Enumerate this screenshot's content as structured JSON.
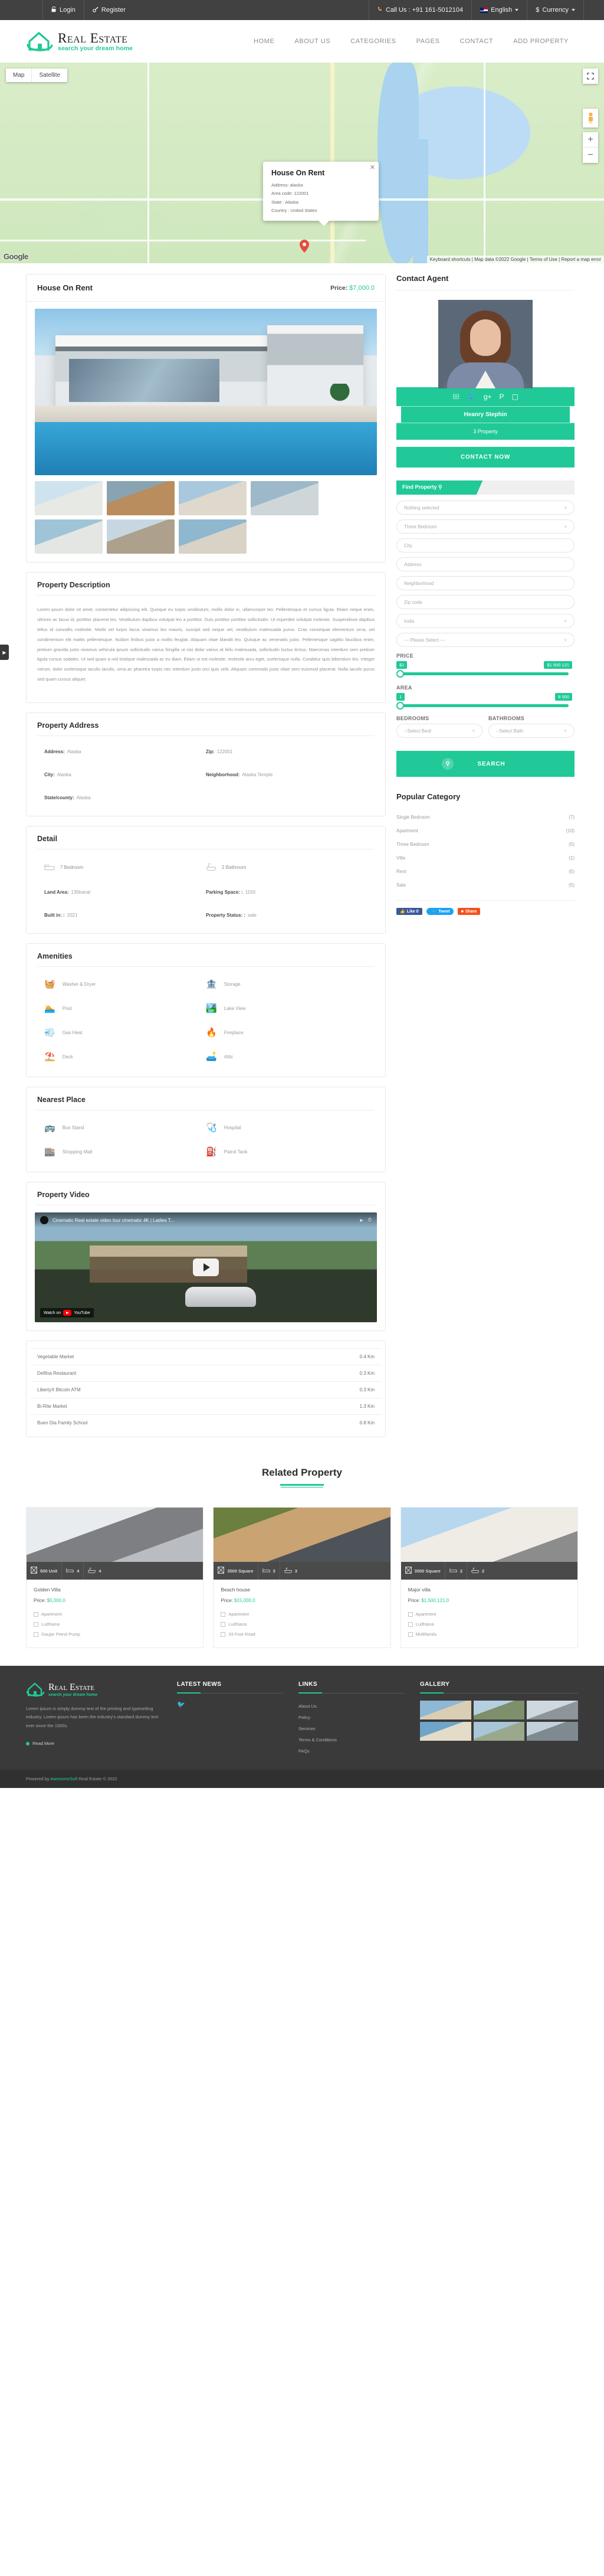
{
  "topbar": {
    "left": [
      {
        "icon": "lock-icon",
        "label": "Login"
      },
      {
        "icon": "key-icon",
        "label": "Register"
      }
    ],
    "call_us": "Call Us : +91 161-5012104",
    "language": "English",
    "currency": "Currency"
  },
  "header": {
    "logo_title": "Real Estate",
    "logo_sub": "search your dream home",
    "nav": [
      "HOME",
      "ABOUT US",
      "CATEGORIES",
      "PAGES",
      "CONTACT",
      "ADD PROPERTY"
    ]
  },
  "map": {
    "btn_map": "Map",
    "btn_satellite": "Satellite",
    "zoom_in": "+",
    "zoom_out": "−",
    "google_logo": "Google",
    "attribution": "Keyboard shortcuts | Map data ©2022 Google | Terms of Use | Report a map error",
    "info": {
      "title": "House On Rent",
      "address": "Address: alaska",
      "area_code": "Area code: 122001",
      "state": "State : Alaska",
      "country": "Country : United States"
    }
  },
  "property": {
    "title": "House On Rent",
    "price_label": "Price:",
    "price_value": "$7,000.0",
    "description_heading": "Property Description",
    "description_p1": "Lorem ipsum dolor sit amet, consectetur adipiscing elit. Quisque eu turpis vestibulum, mollis dolor in, ullamcorper leo. Pellentesque et cursus ligula. Etiam neque enim, ultrices ac lacus id, porttitor placerat leo. Vestibulum dapibus volutpat leo a porttitor. Duis porttitor porttitor sollicitudin. Ut imperdiet volutpat molestie. Suspendisse dapibus tellus id convallis molestie. Morbi vel turpis lacus vivamus leo mauris, suscipit sed neque vel, vestibulum malesuada purus. Cras consequat elementum urna, vel condimentum elit mattis pellentesque. Nullam finibus justo a mollis feugiat. Aliquam vitae blandit leo. Quisque ac venenatis justo. Pellentesque sagittis faucibus enim, pretium gravida justo vivamus vehicula ipsum sollicitudin varius fringilla ut nisi dolor varius at felis malesuada, sollicitudin luctus lectus. Maecenas interdum sem pretium ligula cursus sodales. Ut sed quam a nisl tristique malesuada ac eu diam. Etiam ut est molestie, molestie arcu eget, scelerisque nulla. Curabitur quis bibendum leo. Integer rutrum, dolor scelerisque iaculis iaculis, urna ac pharetra turpis nec interdum justo orci quis velit. Aliquam commodo justo vitae sem euismod placerat. Nulla iaculis purus sed quam cursus aliquet.",
    "address_heading": "Property Address",
    "address": [
      {
        "label": "Address:",
        "value": "Alaska"
      },
      {
        "label": "Zip:",
        "value": "122001"
      },
      {
        "label": "City:",
        "value": "Alaska"
      },
      {
        "label": "Neighborhood:",
        "value": "Alaska Temple"
      },
      {
        "label": "State/county:",
        "value": "Alaska"
      }
    ],
    "detail_heading": "Detail",
    "detail_icons": [
      {
        "icon": "bed-icon",
        "label": "7 Bedroom"
      },
      {
        "icon": "bath-icon",
        "label": "2 Bathroom"
      }
    ],
    "detail_fields": [
      {
        "label": "Land Area:",
        "value": "135kanal"
      },
      {
        "label": "Parking Space: :",
        "value": "1150"
      },
      {
        "label": "Built in: :",
        "value": "2021"
      },
      {
        "label": "Property Status: :",
        "value": "sale"
      }
    ],
    "amenities_heading": "Amenities",
    "amenities": [
      {
        "icon": "washer-icon",
        "emoji": "🧺",
        "label": "Washer & Dryer"
      },
      {
        "icon": "storage-icon",
        "emoji": "🏦",
        "label": "Storage"
      },
      {
        "icon": "pool-icon",
        "emoji": "🏊",
        "label": "Pool"
      },
      {
        "icon": "lake-view-icon",
        "emoji": "🏞️",
        "label": "Lake View"
      },
      {
        "icon": "gas-heat-icon",
        "emoji": "💨",
        "label": "Gas Heat"
      },
      {
        "icon": "fireplace-icon",
        "emoji": "🔥",
        "label": "Fireplace"
      },
      {
        "icon": "deck-icon",
        "emoji": "⛱️",
        "label": "Deck"
      },
      {
        "icon": "attic-icon",
        "emoji": "🛋️",
        "label": "Attic"
      }
    ],
    "nearest_heading": "Nearest Place",
    "nearest": [
      {
        "icon": "bus-stand-icon",
        "emoji": "🚌",
        "label": "Bus Stand"
      },
      {
        "icon": "hospital-icon",
        "emoji": "🩺",
        "label": "Hospital"
      },
      {
        "icon": "shopping-mall-icon",
        "emoji": "🏬",
        "label": "Shopping Mall"
      },
      {
        "icon": "petrol-tank-icon",
        "emoji": "⛽",
        "label": "Patrol Tank"
      }
    ],
    "video_heading": "Property Video",
    "video_title": "Cinematic Real estate video tour cinematic 4K | Ladies T...",
    "video_watch": "Watch on",
    "video_watch_brand": "YouTube",
    "distances": [
      {
        "name": "Vegetable Market",
        "distance": "0.4 Km"
      },
      {
        "name": "Delfina Restaurant",
        "distance": "0.3 Km"
      },
      {
        "name": "LibertyX Bitcoin ATM",
        "distance": "0.3 Km"
      },
      {
        "name": "Bi-Rite Market",
        "distance": "1.3 Km"
      },
      {
        "name": "Buen Dia Family School",
        "distance": "0.8 Km"
      }
    ]
  },
  "sidebar": {
    "contact_agent_title": "Contact Agent",
    "agent_name": "Heanry Stephin",
    "agent_properties": "3 Property",
    "contact_now": "CONTACT NOW",
    "socials": [
      "facebook-icon",
      "twitter-icon",
      "google-plus-icon",
      "pinterest-icon",
      "instagram-icon"
    ],
    "find_property": "Find Property",
    "fields": [
      {
        "name": "category-select",
        "value": "Nothing selected",
        "type": "select"
      },
      {
        "name": "bedroom-type-select",
        "value": "Three Bedroom",
        "type": "select"
      },
      {
        "name": "city-input",
        "value": "City",
        "type": "input"
      },
      {
        "name": "address-input",
        "value": "Address",
        "type": "input"
      },
      {
        "name": "neighborhood-input",
        "value": "Neighborhood",
        "type": "input"
      },
      {
        "name": "zipcode-input",
        "value": "Zip code",
        "type": "input"
      },
      {
        "name": "country-select",
        "value": "India",
        "type": "select"
      },
      {
        "name": "state-select",
        "value": "--- Please Select ---",
        "type": "select"
      }
    ],
    "price_label": "PRICE",
    "price_min": "$1",
    "price_max": "$1 500 121",
    "area_label": "AREA",
    "area_min": "1",
    "area_max": "8 500",
    "bedrooms_label": "BEDROOMS",
    "bedrooms_value": "--Select Bedr",
    "bathrooms_label": "BATHROOMS",
    "bathrooms_value": "--Select Bath",
    "search_button": "SEARCH",
    "popular_category_title": "Popular Category",
    "categories": [
      {
        "label": "Single Bedroom",
        "count": "(7)"
      },
      {
        "label": "Apartment",
        "count": "(10)"
      },
      {
        "label": "Three Bedroom",
        "count": "(5)"
      },
      {
        "label": "Villa",
        "count": "(1)"
      },
      {
        "label": "Rent",
        "count": "(5)"
      },
      {
        "label": "Sale",
        "count": "(5)"
      }
    ],
    "share": [
      {
        "name": "facebook-like-button",
        "label": "Like 0"
      },
      {
        "name": "twitter-tweet-button",
        "label": "Tweet"
      },
      {
        "name": "share-button",
        "label": "Share"
      }
    ]
  },
  "related": {
    "heading": "Related Property",
    "cards": [
      {
        "name": "Golden Villa",
        "price_label": "Price:",
        "price": "$5,000.0",
        "area": "500 Unit",
        "beds": "4",
        "baths": "4",
        "tags": [
          "Apartment",
          "Ludhiana",
          "Gaujar Petrol Pump"
        ]
      },
      {
        "name": "Beach house",
        "price_label": "Price:",
        "price": "$15,000.0",
        "area": "3500 Square",
        "beds": "3",
        "baths": "3",
        "tags": [
          "Apartment",
          "Ludhiana",
          "33 Foot Road"
        ]
      },
      {
        "name": "Major villa",
        "price_label": "Price:",
        "price": "$1,500,121.0",
        "area": "3500 Square",
        "beds": "2",
        "baths": "2",
        "tags": [
          "Apartment",
          "Ludhiana",
          "Multifamilu"
        ]
      }
    ]
  },
  "footer": {
    "logo_title": "Real Estate",
    "logo_sub": "search your dream home",
    "about_text": "Lorem ipsum is simply dummy text of the printing and typesetting industry. Lorem ipsum has been the industry's standard dummy text ever since the 1500s.",
    "read_more": "Read More",
    "latest_news_title": "LATEST NEWS",
    "links_title": "LINKS",
    "links": [
      "About Us",
      "Policy",
      "Services",
      "Terms & Conditions",
      "FAQs"
    ],
    "gallery_title": "GALLERY",
    "copyright_prefix": "Powered by",
    "copyright_brand": "AwesomeSoft",
    "copyright_suffix": "Real Estate © 2022"
  }
}
